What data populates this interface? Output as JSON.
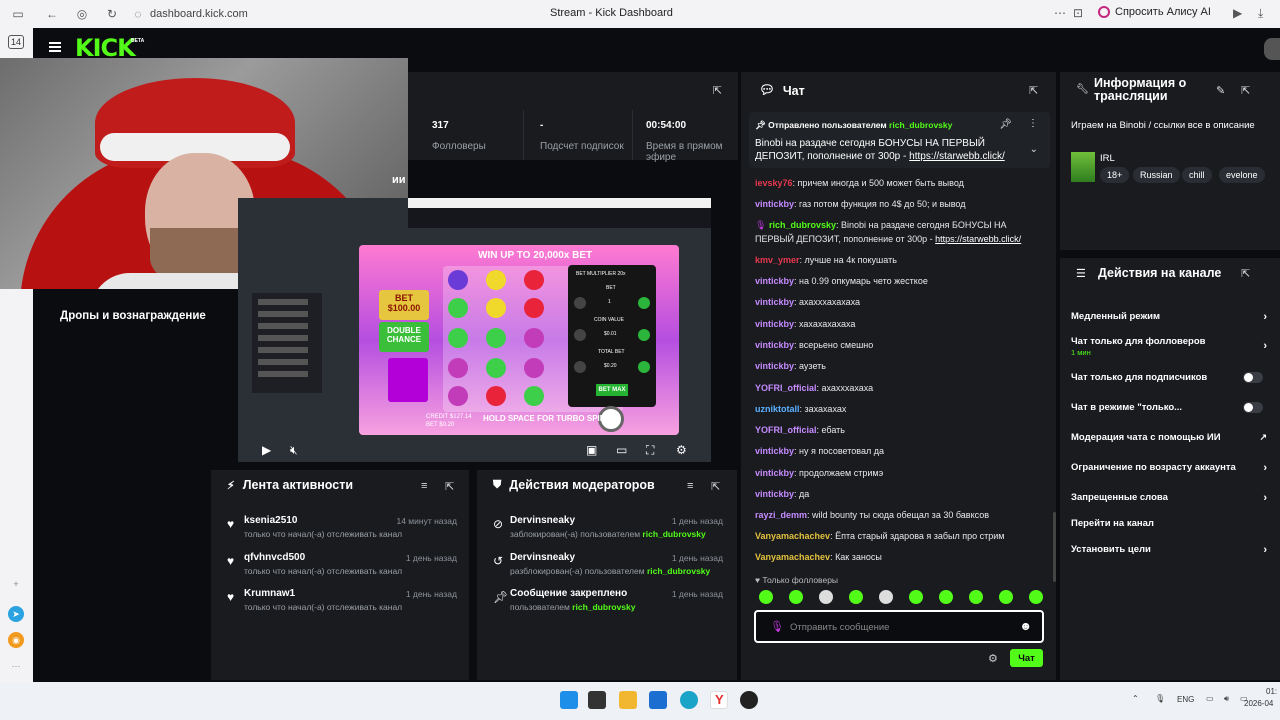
{
  "browser": {
    "url": "dashboard.kick.com",
    "tab_title": "Stream - Kick Dashboard",
    "alice_label": "Спросить Алису AI",
    "tab_count": "14"
  },
  "header": {
    "logo": "KICK",
    "logo_badge": "BETA"
  },
  "stats": {
    "followers_value": "317",
    "followers_label": "Фолловеры",
    "subs_value": "-",
    "subs_label": "Подсчет подписок",
    "live_value": "00:54:00",
    "live_label": "Время в прямом эфире"
  },
  "drops_label": "Дропы и вознаграждение",
  "ingame_label": "ии",
  "video": {
    "win_banner": "WIN UP TO 20,000x BET",
    "bet_label": "BET $100.00",
    "double_label": "DOUBLE CHANCE",
    "hold_text": "HOLD SPACE FOR TURBO SPIN",
    "bet_max": "BET MAX",
    "bet_multiplier": "BET MULTIPLIER 20x",
    "bet_row_label": "BET",
    "coin_label": "COIN VALUE",
    "total_label": "TOTAL BET",
    "bet_value": "1",
    "coin_value": "$0.01",
    "total_value": "$0.20",
    "credit": "CREDIT $127.14",
    "bet_bottom": "BET $0.20"
  },
  "activity": {
    "title": "Лента активности",
    "items": [
      {
        "name": "ksenia2510",
        "time": "14 минут назад",
        "desc": "только что начал(-а) отслеживать канал"
      },
      {
        "name": "qfvhnvcd500",
        "time": "1 день назад",
        "desc": "только что начал(-а) отслеживать канал"
      },
      {
        "name": "Krumnaw1",
        "time": "1 день назад",
        "desc": "только что начал(-а) отслеживать канал"
      }
    ]
  },
  "mods": {
    "title": "Действия модераторов",
    "items": [
      {
        "name": "Dervinsneaky",
        "time": "1 день назад",
        "desc": "заблокирован(-а) пользователем",
        "actor": "rich_dubrovsky"
      },
      {
        "name": "Dervinsneaky",
        "time": "1 день назад",
        "desc": "разблокирован(-а) пользователем",
        "actor": "rich_dubrovsky"
      },
      {
        "name": "Сообщение закреплено",
        "time": "1 день назад",
        "desc": "пользователем",
        "actor": "rich_dubrovsky"
      }
    ]
  },
  "chat": {
    "title": "Чат",
    "pinned_by": "Отправлено пользователем",
    "pinned_user": "rich_dubrovsky",
    "pinned_text": "Binobi на раздаче сегодня БОНУСЫ НА ПЕРВЫЙ ДЕПОЗИТ, пополнение от 300р - ",
    "pinned_link": "https://starwebb.click/",
    "messages": [
      {
        "user": "ievsky76",
        "text": ": причем иногда и 500 может быть вывод",
        "color": "#e8384f"
      },
      {
        "user": "vintickby",
        "text": ": газ потом функция по 4$ до 50; и вывод",
        "color": "#c58bff"
      },
      {
        "user": "rich_dubrovsky",
        "text": ": Binobi на раздаче сегодня БОНУСЫ НА ПЕРВЫЙ ДЕПОЗИТ, пополнение от 300р - ",
        "link": "https://starwebb.click/",
        "color": "#53fc18"
      },
      {
        "user": "kmv_ymer",
        "text": ": лучше на 4к покушать",
        "color": "#e8384f"
      },
      {
        "user": "vintickby",
        "text": ": на 0.99 опкумарь чето жесткое",
        "color": "#c58bff"
      },
      {
        "user": "vintickby",
        "text": ": ахахххахахаха",
        "color": "#c58bff"
      },
      {
        "user": "vintickby",
        "text": ": хахахахахаха",
        "color": "#c58bff"
      },
      {
        "user": "vintickby",
        "text": ": всерьено смешно",
        "color": "#c58bff"
      },
      {
        "user": "vintickby",
        "text": ": аузеть",
        "color": "#c58bff"
      },
      {
        "user": "YOFRI_official",
        "text": ": ахахххахаха",
        "color": "#c58bff"
      },
      {
        "user": "uzniktotall",
        "text": ": захахахах",
        "color": "#5bb0ff"
      },
      {
        "user": "YOFRI_official",
        "text": ": ебать",
        "color": "#c58bff"
      },
      {
        "user": "vintickby",
        "text": ": ну я посоветовал да",
        "color": "#c58bff"
      },
      {
        "user": "vintickby",
        "text": ": продолжаем стримэ",
        "color": "#c58bff"
      },
      {
        "user": "vintickby",
        "text": ": да",
        "color": "#c58bff"
      },
      {
        "user": "rayzi_demm",
        "text": ": wild bounty ты сюда обещал за 30 бавксов",
        "color": "#c58bff"
      },
      {
        "user": "Vanyamachachev",
        "text": ": Ёпта старый здарова я забыл про стрим",
        "color": "#e2c13d"
      },
      {
        "user": "Vanyamachachev",
        "text": ": Как заносы",
        "color": "#e2c13d"
      }
    ],
    "followers_only": "Только фолловеры",
    "input_placeholder": "Отправить сообщение",
    "send_label": "Чат"
  },
  "info": {
    "title": "Информация о трансляции",
    "description": "Играем на Binobi / ссылки все в описание",
    "category": "IRL",
    "tags": [
      "18+",
      "Russian",
      "chill",
      "evelone"
    ]
  },
  "actions": {
    "title": "Действия на канале",
    "items": [
      {
        "label": "Медленный режим",
        "type": "chevron"
      },
      {
        "label": "Чат только для фолловеров",
        "sub": "1 мин",
        "type": "chevron"
      },
      {
        "label": "Чат только для подписчиков",
        "type": "toggle"
      },
      {
        "label": "Чат в режиме \"только...",
        "type": "toggle"
      },
      {
        "label": "Модерация чата с помощью ИИ",
        "type": "external"
      },
      {
        "label": "Ограничение по возрасту аккаунта",
        "type": "chevron"
      },
      {
        "label": "Запрещенные слова",
        "type": "chevron"
      },
      {
        "label": "Перейти на канал",
        "type": "none"
      },
      {
        "label": "Установить цели",
        "type": "chevron"
      }
    ]
  },
  "taskbar": {
    "lang": "ENG",
    "time": "01:",
    "date": "2026-04"
  },
  "colors": {
    "accent": "#53fc18",
    "panel": "#191b1f",
    "background": "#0b0c0f"
  }
}
